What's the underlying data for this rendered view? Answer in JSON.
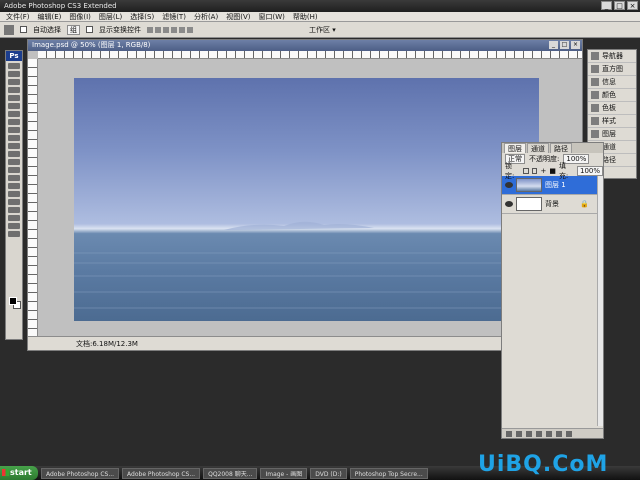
{
  "window": {
    "title": "Adobe Photoshop CS3 Extended"
  },
  "menu": [
    "文件(F)",
    "编辑(E)",
    "图像(I)",
    "图层(L)",
    "选择(S)",
    "滤镜(T)",
    "分析(A)",
    "视图(V)",
    "窗口(W)",
    "帮助(H)"
  ],
  "options": {
    "auto_select": "自动选择",
    "auto_select_value": "组",
    "show_transform": "显示变换控件",
    "workspace": "工作区 ▾"
  },
  "document": {
    "title": "Image.psd @ 50% (图层 1, RGB/8)",
    "status": "文档:6.18M/12.3M",
    "photo_desc": "sea horizon"
  },
  "navigator": {
    "items": [
      "导航器",
      "直方图",
      "信息",
      "颜色",
      "色板",
      "样式",
      "图层",
      "通道",
      "路径"
    ]
  },
  "layers": {
    "tabs": [
      "图层",
      "通道",
      "路径"
    ],
    "blend_mode": "正常",
    "opacity_label": "不透明度:",
    "opacity_value": "100%",
    "lock_label": "锁定:",
    "fill_label": "填充:",
    "fill_value": "100%",
    "rows": [
      {
        "name": "图层 1",
        "selected": true
      },
      {
        "name": "背景",
        "selected": false
      }
    ]
  },
  "taskbar": {
    "start": "start",
    "tasks": [
      "Adobe Photoshop CS...",
      "Adobe Photoshop CS...",
      "QQ2008 聊天...",
      "Image - 画图",
      "DVD (D:)",
      "Photoshop Top Secre..."
    ]
  },
  "watermark": "UiBQ.CoM"
}
